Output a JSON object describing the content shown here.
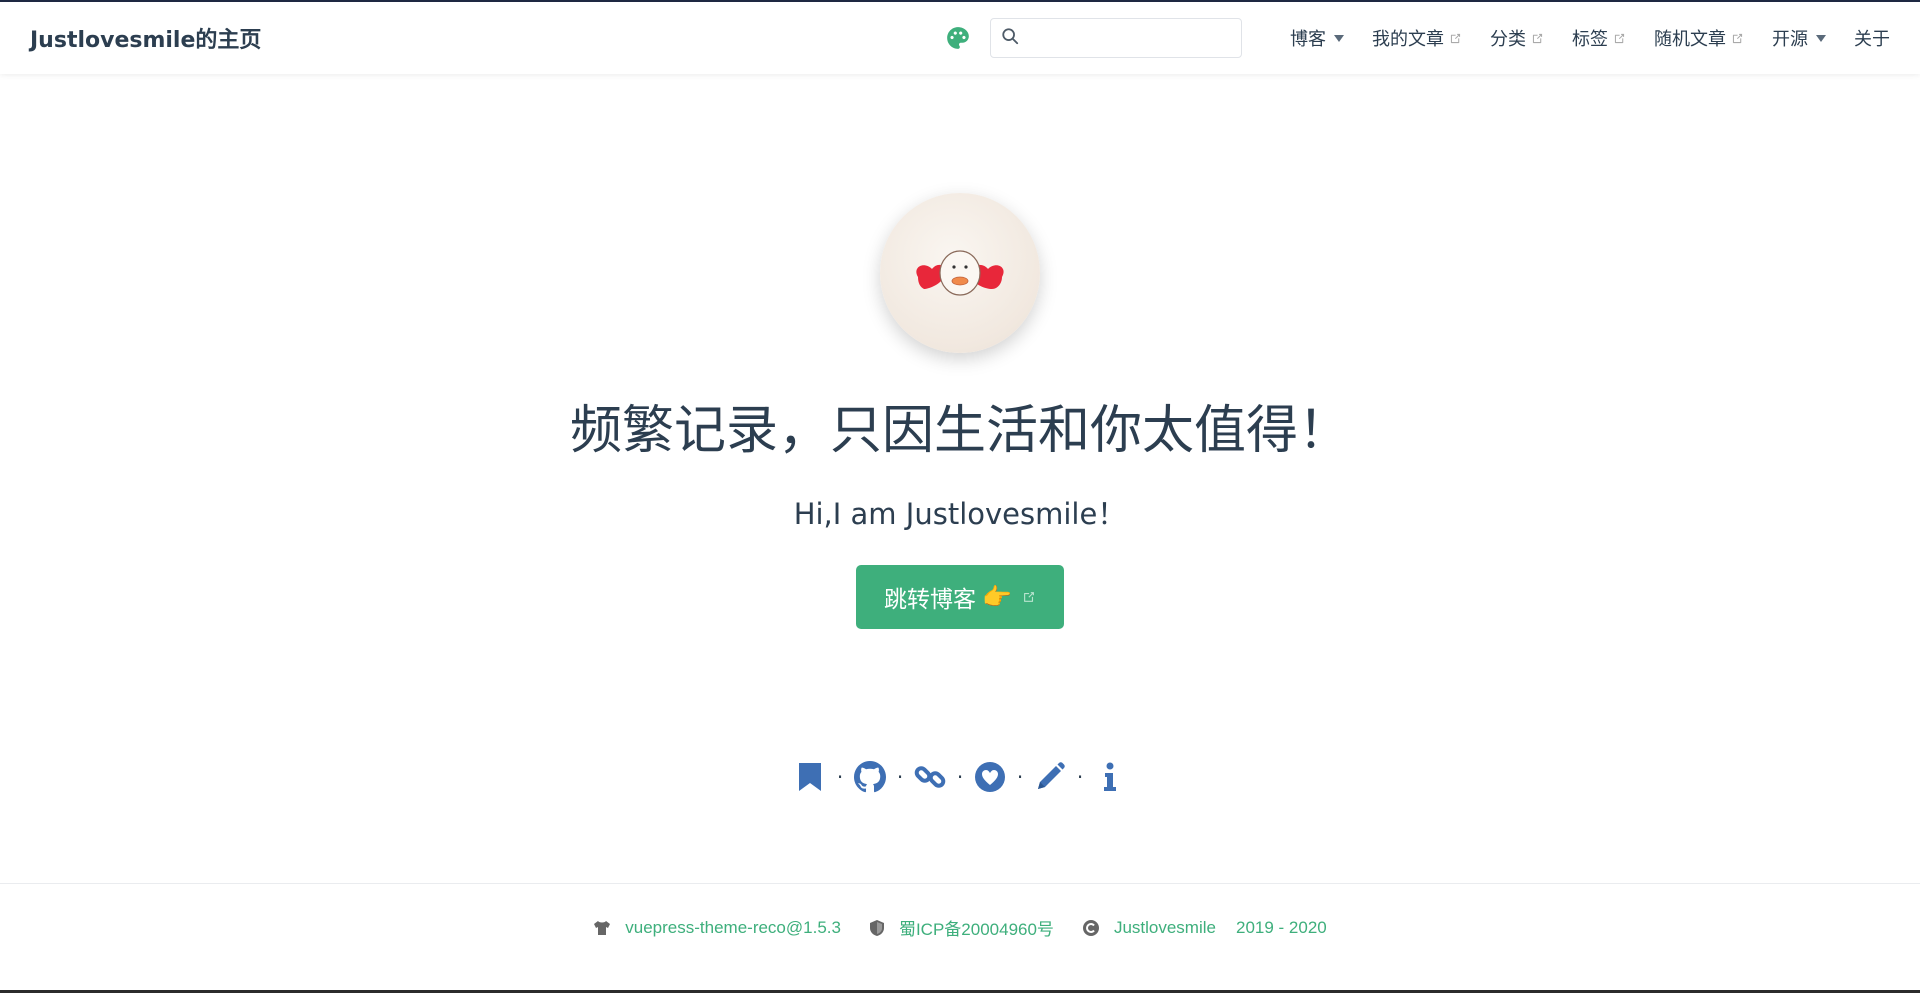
{
  "site": {
    "name": "Justlovesmile的主页"
  },
  "navbar": {
    "search_placeholder": "",
    "items": [
      {
        "label": "博客",
        "type": "dropdown"
      },
      {
        "label": "我的文章",
        "type": "external"
      },
      {
        "label": "分类",
        "type": "external"
      },
      {
        "label": "标签",
        "type": "external"
      },
      {
        "label": "随机文章",
        "type": "external"
      },
      {
        "label": "开源",
        "type": "dropdown"
      },
      {
        "label": "关于",
        "type": "link"
      }
    ]
  },
  "hero": {
    "title": "频繁记录，只因生活和你太值得！",
    "subtitle": "Hi,I am Justlovesmile！",
    "button_label": "跳转博客",
    "button_emoji": "👉"
  },
  "social_icons": [
    "bookmark-icon",
    "github-icon",
    "link-icon",
    "heart-icon",
    "pencil-icon",
    "info-icon"
  ],
  "footer": {
    "theme": "vuepress-theme-reco@1.5.3",
    "icp": "蜀ICP备20004960号",
    "author": "Justlovesmile",
    "years": "2019 - 2020"
  },
  "colors": {
    "accent": "#3eaf7c",
    "social": "#3e6fb4",
    "text": "#2c3e50"
  }
}
